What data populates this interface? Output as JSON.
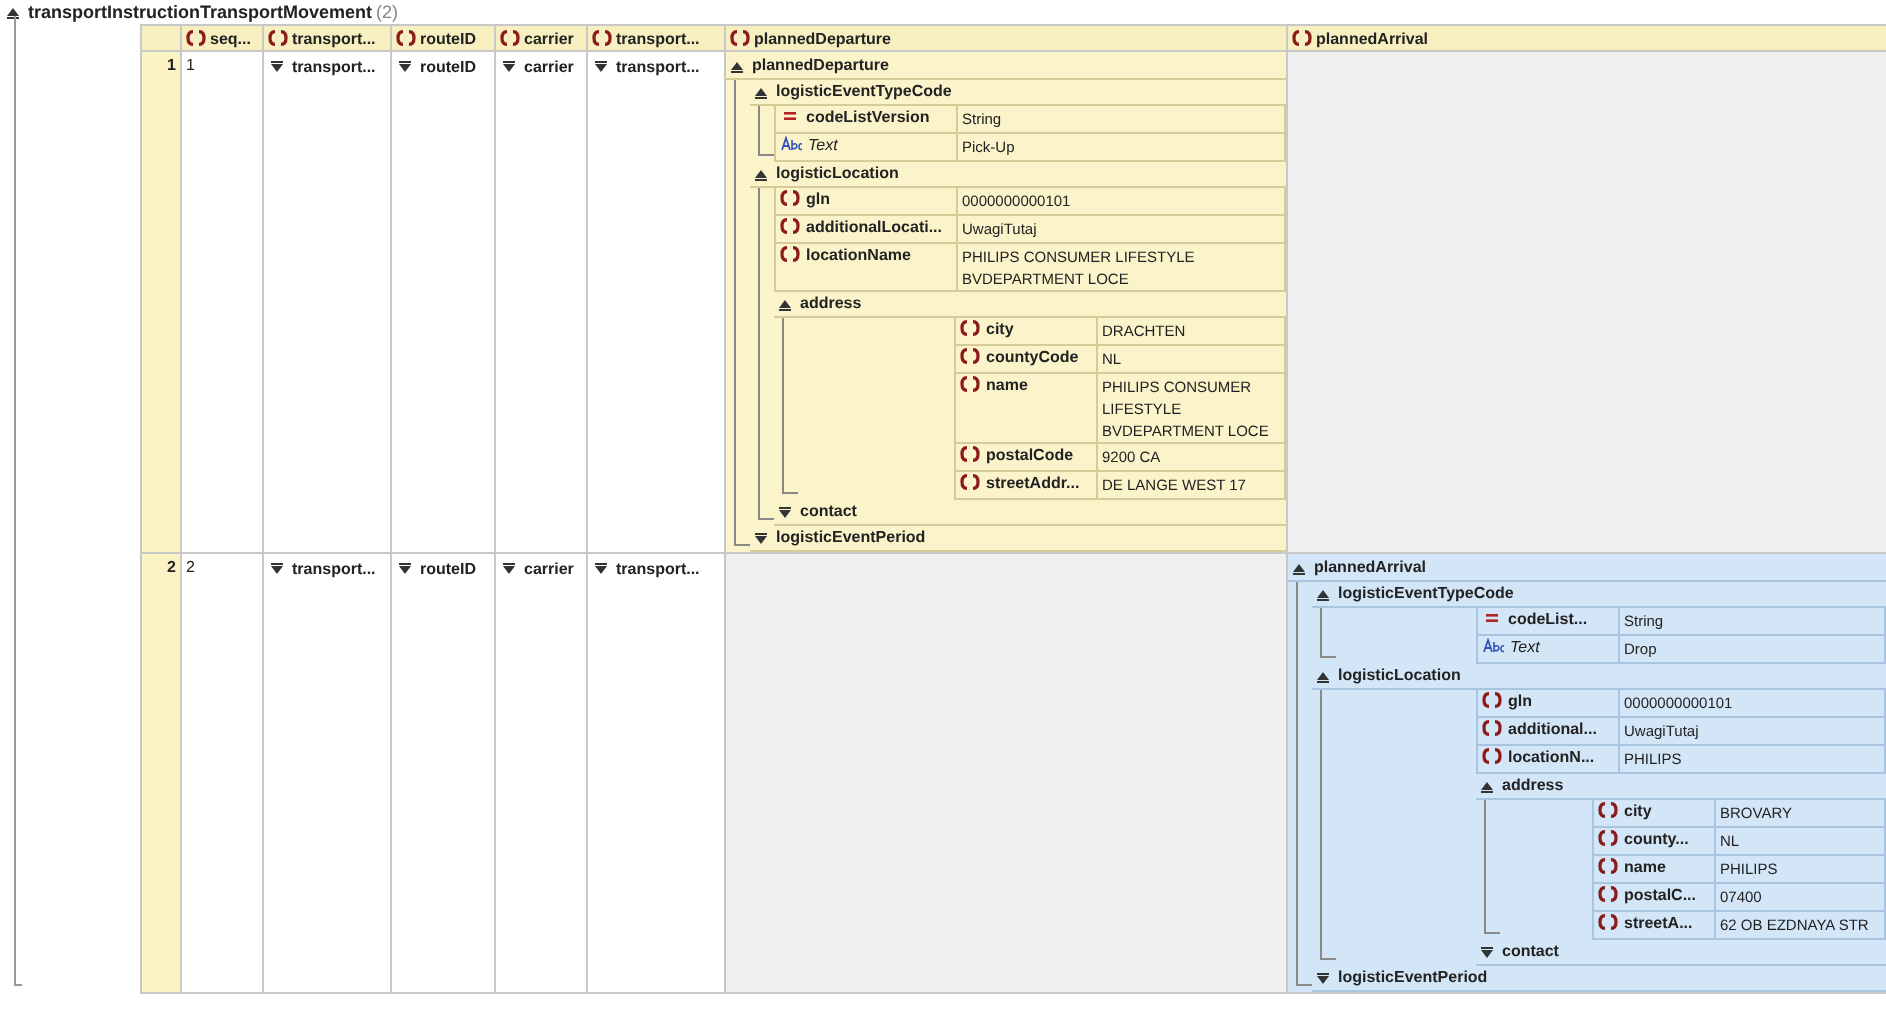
{
  "table": {
    "title": "transportInstructionTransportMovement",
    "count": "(2)",
    "expanded": true,
    "columns": [
      {
        "name": "seq..."
      },
      {
        "name": "transport..."
      },
      {
        "name": "routeID"
      },
      {
        "name": "carrier"
      },
      {
        "name": "transport..."
      },
      {
        "name": "plannedDeparture"
      },
      {
        "name": "plannedArrival"
      }
    ],
    "rows": [
      {
        "number": "1",
        "cells": [
          {
            "kind": "value",
            "text": "1"
          },
          {
            "kind": "collapsed",
            "text": "transport..."
          },
          {
            "kind": "collapsed",
            "text": "routeID"
          },
          {
            "kind": "collapsed",
            "text": "carrier"
          },
          {
            "kind": "collapsed",
            "text": "transport..."
          },
          {
            "kind": "tree",
            "node": {
              "kind": "group",
              "name": "plannedDeparture",
              "expanded": true,
              "children": [
                {
                  "kind": "group",
                  "name": "logisticEventTypeCode",
                  "expanded": true,
                  "children": [
                    {
                      "kind": "attribute",
                      "name": "codeListVersion",
                      "value": "String"
                    },
                    {
                      "kind": "text",
                      "name": "Text",
                      "value": "Pick-Up"
                    }
                  ]
                },
                {
                  "kind": "group",
                  "name": "logisticLocation",
                  "expanded": true,
                  "children": [
                    {
                      "kind": "element",
                      "name": "gln",
                      "value": "0000000000101"
                    },
                    {
                      "kind": "element",
                      "name": "additionalLocati...",
                      "value": "UwagiTutaj"
                    },
                    {
                      "kind": "element",
                      "name": "locationName",
                      "value": "PHILIPS CONSUMER LIFESTYLE BVDEPARTMENT LOCE"
                    },
                    {
                      "kind": "group",
                      "name": "address",
                      "expanded": true,
                      "children": [
                        {
                          "kind": "element",
                          "name": "city",
                          "value": "DRACHTEN"
                        },
                        {
                          "kind": "element",
                          "name": "countyCode",
                          "value": "NL"
                        },
                        {
                          "kind": "element",
                          "name": "name",
                          "value": "PHILIPS CONSUMER LIFESTYLE BVDEPARTMENT LOCE"
                        },
                        {
                          "kind": "element",
                          "name": "postalCode",
                          "value": "9200 CA"
                        },
                        {
                          "kind": "element",
                          "name": "streetAddr...",
                          "value": "DE LANGE WEST 17"
                        }
                      ]
                    },
                    {
                      "kind": "group",
                      "name": "contact",
                      "expanded": false
                    }
                  ]
                },
                {
                  "kind": "group",
                  "name": "logisticEventPeriod",
                  "expanded": false
                }
              ]
            }
          },
          {
            "kind": "empty"
          }
        ]
      },
      {
        "number": "2",
        "cells": [
          {
            "kind": "value",
            "text": "2"
          },
          {
            "kind": "collapsed",
            "text": "transport..."
          },
          {
            "kind": "collapsed",
            "text": "routeID"
          },
          {
            "kind": "collapsed",
            "text": "carrier"
          },
          {
            "kind": "collapsed",
            "text": "transport..."
          },
          {
            "kind": "empty"
          },
          {
            "kind": "tree",
            "node": {
              "kind": "group",
              "name": "plannedArrival",
              "expanded": true,
              "children": [
                {
                  "kind": "group",
                  "name": "logisticEventTypeCode",
                  "expanded": true,
                  "children": [
                    {
                      "kind": "attribute",
                      "name": "codeList...",
                      "value": "String"
                    },
                    {
                      "kind": "text",
                      "name": "Text",
                      "value": "Drop"
                    }
                  ]
                },
                {
                  "kind": "group",
                  "name": "logisticLocation",
                  "expanded": true,
                  "children": [
                    {
                      "kind": "element",
                      "name": "gln",
                      "value": "0000000000101"
                    },
                    {
                      "kind": "element",
                      "name": "additional...",
                      "value": "UwagiTutaj"
                    },
                    {
                      "kind": "element",
                      "name": "locationN...",
                      "value": "PHILIPS"
                    },
                    {
                      "kind": "group",
                      "name": "address",
                      "expanded": true,
                      "children": [
                        {
                          "kind": "element",
                          "name": "city",
                          "value": "BROVARY"
                        },
                        {
                          "kind": "element",
                          "name": "county...",
                          "value": "NL"
                        },
                        {
                          "kind": "element",
                          "name": "name",
                          "value": "PHILIPS"
                        },
                        {
                          "kind": "element",
                          "name": "postalC...",
                          "value": "07400"
                        },
                        {
                          "kind": "element",
                          "name": "streetA...",
                          "value": "62 OB EZDNAYA STR"
                        }
                      ]
                    },
                    {
                      "kind": "group",
                      "name": "contact",
                      "expanded": false
                    }
                  ]
                },
                {
                  "kind": "group",
                  "name": "logisticEventPeriod",
                  "expanded": false
                }
              ]
            }
          }
        ]
      }
    ]
  }
}
